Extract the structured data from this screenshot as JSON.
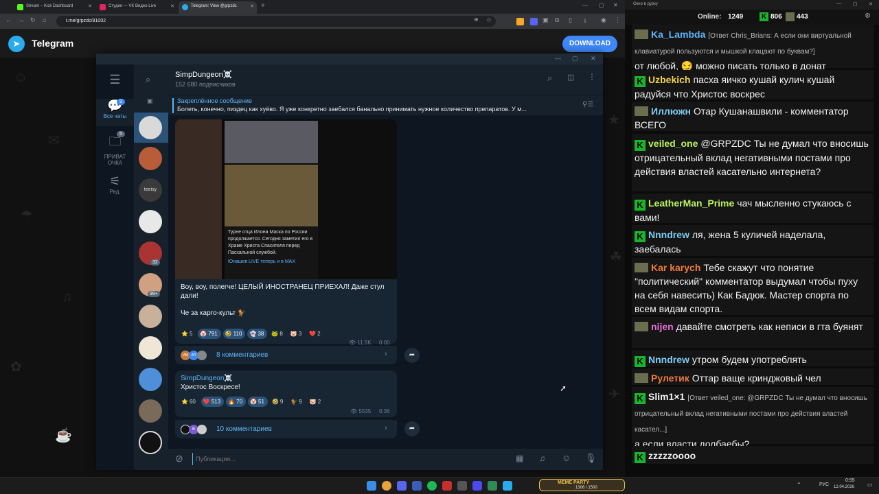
{
  "browser": {
    "tabs": [
      {
        "title": "Stream – Kick Dashboard",
        "color": "#53fc18"
      },
      {
        "title": "Студия — VK Видео Live",
        "color": "#e0245e"
      },
      {
        "title": "Telegram: View @grpzdc",
        "color": "#2aabee"
      }
    ],
    "url": "t.me/grpzdc/81002"
  },
  "tg_page": {
    "title": "Telegram",
    "download_label": "DOWNLOAD"
  },
  "tg_app": {
    "folders": [
      {
        "label": "Все чаты",
        "badge": "9"
      },
      {
        "label": "ПРИВАТ ОЧКА",
        "badge": "5"
      },
      {
        "label": "Ред.",
        "badge": ""
      }
    ],
    "chat_badges": [
      "32",
      "99+"
    ],
    "chat_avatar_text": "teeisy",
    "channel": {
      "name": "SimpDungeon☠️",
      "subscribers": "152 680 подписчиков"
    },
    "pinned": {
      "label": "Закреплённое сообщение",
      "text": "Болеть, конечно, пиздец как хуёво. Я уже конкретно заебался банально принимать нужное количество препаратов. У м..."
    },
    "post1": {
      "image_caption": "Турне отца Илона Маска по России продолжается. Сегодня заметил его в Храме Христа Спасителя перед Пасхальной службой.",
      "image_watermark": "Юнашев LIVE теперь и в MAX",
      "text1": "Воу, воу, полегче! ЦЕЛЫЙ ИНОСТРАНЕЦ ПРИЕХАЛ! Даже стул дали!",
      "text2": "Че за карго-культ 🐓",
      "reactions": [
        {
          "emoji": "⭐",
          "count": "5",
          "active": false
        },
        {
          "emoji": "🤡",
          "count": "791",
          "active": true
        },
        {
          "emoji": "🤣",
          "count": "110",
          "active": true
        },
        {
          "emoji": "👻",
          "count": "38",
          "active": true
        },
        {
          "emoji": "🐸",
          "count": "8",
          "active": false
        },
        {
          "emoji": "🐷",
          "count": "3",
          "active": false
        },
        {
          "emoji": "❤️",
          "count": "2",
          "active": false
        }
      ],
      "views": "👁 11.5K",
      "time": "0:00",
      "comments": "8 комментариев",
      "comment_avatars": [
        "ИМ",
        "АП"
      ]
    },
    "post2": {
      "author": "SimpDungeon☠️",
      "text": "Христос Воскресе!",
      "reactions": [
        {
          "emoji": "⭐",
          "count": "60",
          "active": false
        },
        {
          "emoji": "❤️",
          "count": "513",
          "active": true
        },
        {
          "emoji": "🔥",
          "count": "70",
          "active": true
        },
        {
          "emoji": "🤡",
          "count": "51",
          "active": true
        },
        {
          "emoji": "🤣",
          "count": "9",
          "active": false
        },
        {
          "emoji": "🐓",
          "count": "9",
          "active": false
        },
        {
          "emoji": "🐷",
          "count": "2",
          "active": false
        }
      ],
      "views": "👁 5535",
      "time": "0:36",
      "comments": "10 комментариев",
      "comment_avatars": [
        "В"
      ]
    },
    "compose_placeholder": "Публикация..."
  },
  "stream_chat": {
    "window_title": "Окно в дурку",
    "online_label": "Online:",
    "online_value": "1249",
    "stat1": "806",
    "stat2": "443",
    "messages": [
      {
        "nick": "Ka_Lambda",
        "color": "#5eb5f7",
        "badge": "pic",
        "reply": "[Ответ Chris_Brians: А если они виртуальной клавиатурой пользуются и мышкой клацают по буквам?]",
        "text": "от любой, 😏 можно писать только в донат"
      },
      {
        "nick": "Uzbekich",
        "color": "#f0d34a",
        "badge": "k",
        "reply": "",
        "text": "пасха яичко кушай кулич кушай радуйся что Христос воскрес"
      },
      {
        "nick": "Иллюжн",
        "color": "#7ecbf2",
        "badge": "pic",
        "reply": "",
        "text": "Отар Кушанашвили - комментатор ВСЕГО"
      },
      {
        "nick": "veiled_one",
        "color": "#b8f25a",
        "badge": "k",
        "reply": "",
        "text": "@GRPZDC Ты не думал что вносишь отрицательный вклад негативными постами про действия властей касательно интернета?"
      },
      {
        "nick": "LeatherMan_Prime",
        "color": "#b8f25a",
        "badge": "k",
        "reply": "",
        "text": "чач мысленно стукаюсь с вами!"
      },
      {
        "nick": "Nnndrew",
        "color": "#7ecbf2",
        "badge": "k",
        "reply": "",
        "text": "ля, жена 5 куличей наделала, заебалась"
      },
      {
        "nick": "Kar karych",
        "color": "#f07a3a",
        "badge": "pic",
        "reply": "",
        "text": "Тебе скажут что понятие \"политический\" комментатор выдумал чтобы пуху на себя навесить) Как Бадюк. Мастер спорта по всем видам спорта."
      },
      {
        "nick": "nijen",
        "color": "#e66bd6",
        "badge": "pic",
        "reply": "",
        "text": "давайте смотреть как неписи в гта буянят"
      },
      {
        "nick": "Nnndrew",
        "color": "#7ecbf2",
        "badge": "k",
        "reply": "",
        "text": "утром будем употреблять"
      },
      {
        "nick": "Рулетик",
        "color": "#f07a3a",
        "badge": "pic",
        "reply": "",
        "text": "Оттар ваще кринджовый чел"
      },
      {
        "nick": "Slim1×1",
        "color": "#f0f0f0",
        "badge": "k",
        "reply": "[Ответ veiled_one: @GRPZDC Ты не думал что вносишь отрицательный вклад негативными постами про действия властей касател...]",
        "text": "а если власти долбаебы?"
      },
      {
        "nick": "zzzzzoooo",
        "color": "#f0f0f0",
        "badge": "k",
        "reply": "",
        "text": ""
      }
    ]
  },
  "taskbar": {
    "widget_label": "MEME PARTY",
    "widget_count": "1306 / 1500",
    "lang": "РУС",
    "time": "0:55",
    "date": "12.04.2026"
  }
}
